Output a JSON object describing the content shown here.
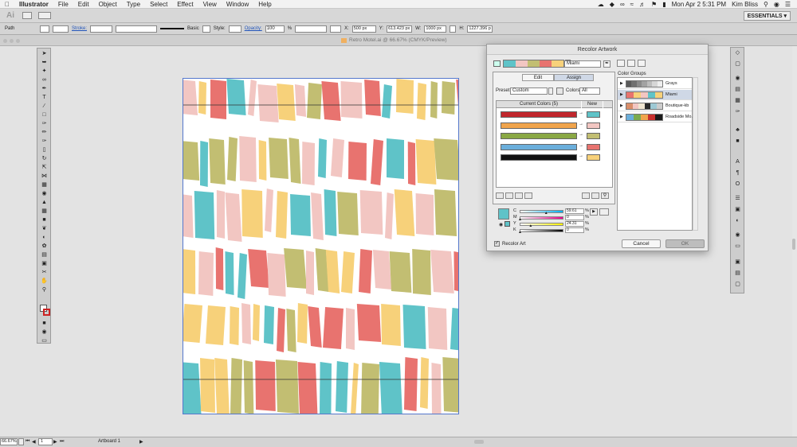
{
  "menubar": {
    "app": "Illustrator",
    "items": [
      "File",
      "Edit",
      "Object",
      "Type",
      "Select",
      "Effect",
      "View",
      "Window",
      "Help"
    ],
    "datetime": "Mon Apr 2  5:31 PM",
    "user": "Kim Bliss"
  },
  "appbar": {
    "logo": "Ai",
    "workspace": "ESSENTIALS ▾"
  },
  "controlbar": {
    "selection": "Path",
    "stroke_label": "Stroke:",
    "brush": "Basic",
    "style_label": "Style:",
    "opacity_label": "Opacity:",
    "opacity_value": "100",
    "pct": "%",
    "x_label": "X:",
    "x_value": "500 px",
    "y_label": "Y:",
    "y_value": "613.423 px",
    "w_label": "W:",
    "w_value": "1000 px",
    "h_label": "H:",
    "h_value": "1227.396 p"
  },
  "doc_title": "Retro Motel.ai @ 66.67% (CMYK/Preview)",
  "dialog": {
    "title": "Recolor Artwork",
    "harmony_name": "Miami",
    "tab_edit": "Edit",
    "tab_assign": "Assign",
    "preset_label": "Preset:",
    "preset_value": "Custom",
    "colors_label": "Colors:",
    "colors_value": "All",
    "current_colors_header": "Current Colors (5)",
    "new_header": "New",
    "cmyk": [
      {
        "label": "C",
        "value": "59.61",
        "unit": "%",
        "pos": 0.596
      },
      {
        "label": "M",
        "value": "0",
        "unit": "%",
        "pos": 0.0
      },
      {
        "label": "Y",
        "value": "24.31",
        "unit": "%",
        "pos": 0.243
      },
      {
        "label": "K",
        "value": "0",
        "unit": "%",
        "pos": 0.0
      }
    ],
    "recolor_art_label": "Recolor Art",
    "cancel_label": "Cancel",
    "ok_label": "OK",
    "color_groups_label": "Color Groups",
    "groups": [
      {
        "name": "Grays",
        "colors": [
          "#5a5a5a",
          "#707070",
          "#8a8a8a",
          "#a2a2a2",
          "#bcbcbc",
          "#d6d6d6",
          "#eeeeee"
        ]
      },
      {
        "name": "Miami",
        "colors": [
          "#e8736f",
          "#f7d17a",
          "#f2c6c2",
          "#5fc3c8",
          "#f7d17a"
        ]
      },
      {
        "name": "Boutique-kb",
        "colors": [
          "#d98e6a",
          "#f2c6c2",
          "#f0e6d2",
          "#2a2a2a",
          "#9ec9d4",
          "#cccccc"
        ]
      },
      {
        "name": "Roadside Mo...",
        "colors": [
          "#6aaedb",
          "#7aaa4e",
          "#f0a44c",
          "#c8302e",
          "#1a1a1a"
        ]
      }
    ],
    "current_colors": [
      "#c0272d",
      "#f0a44c",
      "#8aa844",
      "#6aaedb",
      "#111111"
    ],
    "new_colors": [
      "#5fc3c8",
      "#f2c6c2",
      "#c2be72",
      "#e8736f",
      "#f7d17a"
    ],
    "swatch_color": "#5fc3c8"
  },
  "statusbar": {
    "zoom": "66.67%",
    "page": "1",
    "artboard": "Artboard 1"
  },
  "art_colors": {
    "pink": "#f2c6c2",
    "coral": "#e8736f",
    "teal": "#5fc3c8",
    "olive": "#c2be72",
    "yellow": "#f7d17a"
  }
}
